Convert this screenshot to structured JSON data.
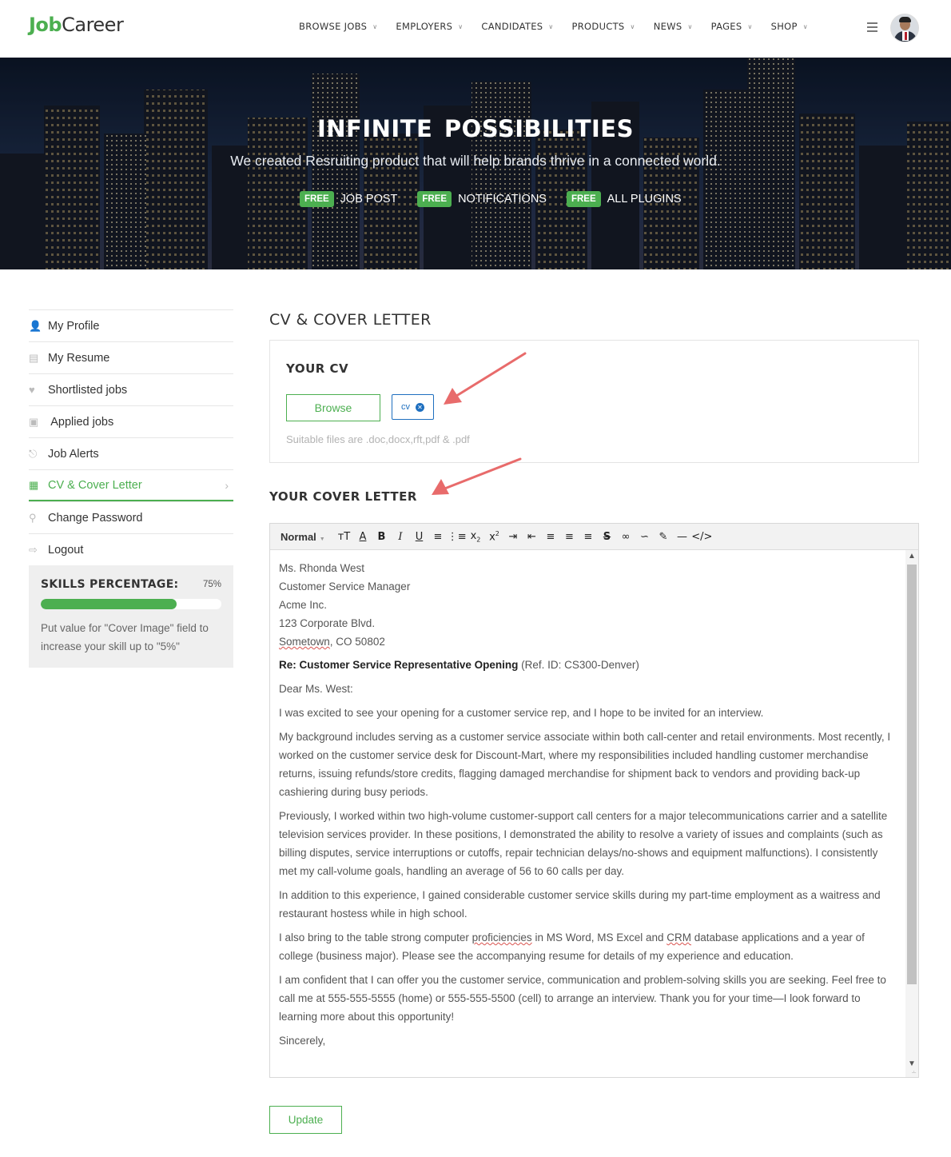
{
  "brand": {
    "part1": "Job",
    "part2": "Career",
    "accent": "#4caf50"
  },
  "nav": [
    {
      "label": "BROWSE JOBS"
    },
    {
      "label": "EMPLOYERS"
    },
    {
      "label": "CANDIDATES"
    },
    {
      "label": "PRODUCTS"
    },
    {
      "label": "NEWS"
    },
    {
      "label": "PAGES"
    },
    {
      "label": "SHOP"
    }
  ],
  "hero": {
    "title": "INFINITE  POSSIBILITIES",
    "subtitle": "We created Resruiting product that will help brands thrive in a connected world.",
    "badges": [
      {
        "badge": "FREE",
        "label": "JOB POST"
      },
      {
        "badge": "FREE",
        "label": "NOTIFICATIONS"
      },
      {
        "badge": "FREE",
        "label": "ALL PLUGINS"
      }
    ]
  },
  "sidebar": {
    "items": [
      {
        "label": "My Profile",
        "icon": "user-icon"
      },
      {
        "label": "My Resume",
        "icon": "document-icon"
      },
      {
        "label": "Shortlisted jobs",
        "icon": "heart-icon"
      },
      {
        "label": " Applied jobs",
        "icon": "briefcase-icon"
      },
      {
        "label": "Job Alerts",
        "icon": "bell-icon"
      },
      {
        "label": "CV & Cover Letter",
        "icon": "id-card-icon"
      },
      {
        "label": "Change Password",
        "icon": "key-icon"
      },
      {
        "label": "Logout",
        "icon": "logout-icon"
      }
    ],
    "active_index": 5
  },
  "skills": {
    "title": "SKILLS PERCENTAGE:",
    "percent_text": "75%",
    "percent": 0.75,
    "hint": "Put value for \"Cover Image\" field to increase your skill up to \"5%\""
  },
  "main": {
    "page_title": "CV & COVER LETTER",
    "cv": {
      "title": "YOUR CV",
      "browse_label": "Browse",
      "file_chip": "cv",
      "hint": "Suitable files are .doc,docx,rft,pdf & .pdf"
    },
    "cover": {
      "title": "YOUR COVER LETTER",
      "format": "Normal",
      "letter": {
        "name": "Ms. Rhonda West",
        "position": "Customer Service Manager",
        "company": "Acme Inc.",
        "street": "123 Corporate Blvd.",
        "city": "Sometown",
        "state_zip": ", CO 50802",
        "re_bold": "Re: Customer Service Representative Opening",
        "re_ref": " (Ref. ID: CS300-Denver)",
        "greeting": "Dear Ms. West:",
        "p1": "I was excited to see your opening for a customer service rep, and I hope to be invited for an interview.",
        "p2": "My background includes serving as a customer service associate within both call-center and retail environments. Most recently, I worked on the customer service desk for Discount-Mart, where my responsibilities included handling customer merchandise returns, issuing refunds/store credits, flagging damaged merchandise for shipment back to vendors and providing back-up cashiering during busy periods.",
        "p3": "Previously, I worked within two high-volume customer-support call centers for a major telecommunications carrier and a satellite television services provider. In these positions, I demonstrated the ability to resolve a variety of issues and complaints (such as billing disputes, service interruptions or cutoffs, repair technician delays/no-shows and equipment malfunctions). I consistently met my call-volume goals, handling an average of 56 to 60 calls per day.",
        "p4": "In addition to this experience, I gained considerable customer service skills during my part-time employment as a waitress and restaurant hostess while in high school.",
        "p5a": "I also bring to the table strong computer ",
        "p5b": "proficiencies",
        "p5c": " in MS Word, MS Excel and ",
        "p5d": "CRM",
        "p5e": " database applications and a year of college (business major). Please see the accompanying resume for details of my experience and education.",
        "p6": "I am confident that I can offer you the customer service, communication and problem-solving skills you are seeking. Feel free to call me at 555-555-5555 (home) or 555-555-5500 (cell) to arrange an interview. Thank you for your time—I look forward to learning more about this opportunity!",
        "closing": "Sincerely,"
      }
    },
    "update_label": "Update"
  }
}
